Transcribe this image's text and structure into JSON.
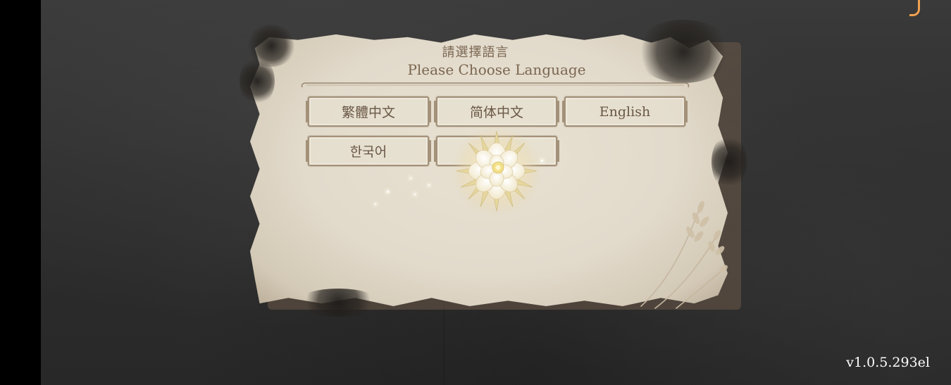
{
  "dialog": {
    "title_chinese": "請選擇語言",
    "title_english": "Please Choose Language"
  },
  "languages": [
    {
      "label": "繁體中文"
    },
    {
      "label": "简体中文"
    },
    {
      "label": "English"
    },
    {
      "label": "한국어"
    },
    {
      "label": ""
    }
  ],
  "footer": {
    "version": "v1.0.5.293el"
  },
  "colors": {
    "parchment": "#e2dacb",
    "ink": "#7a6650",
    "button_border": "#a39179",
    "background": "#2e2e2e",
    "version_text": "#ffffff"
  },
  "icons": {
    "loading_indicator": "glowing-lotus-flower-icon",
    "decoration": "wheat-sprig-icon"
  }
}
